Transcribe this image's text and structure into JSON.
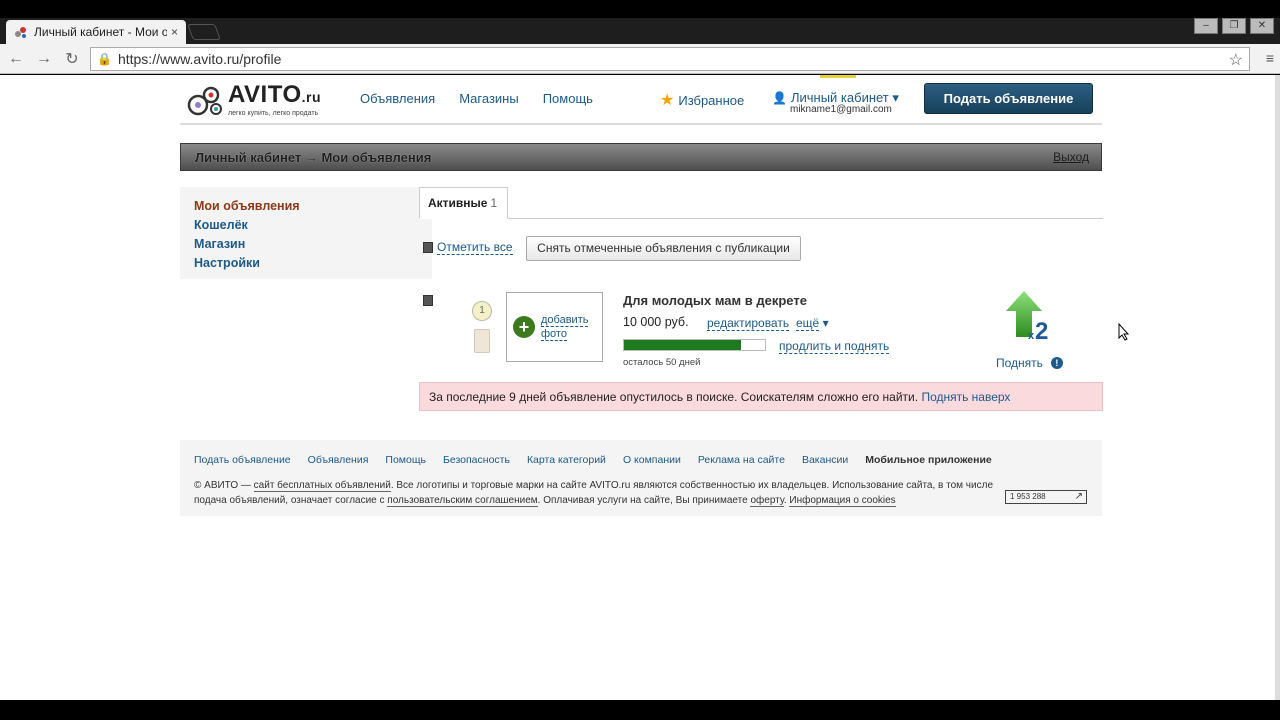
{
  "browser": {
    "tab_title": "Личный кабинет - Мои о",
    "tab_close": "×",
    "url": "https://www.avito.ru/profile"
  },
  "header": {
    "logo_name": "AVITO",
    "logo_suffix": ".ru",
    "logo_tagline": "легко купить, легко продать",
    "nav": [
      "Объявления",
      "Магазины",
      "Помощь"
    ],
    "favorites": "Избранное",
    "cabinet": "Личный кабинет ▾",
    "email": "mikname1@gmail.com",
    "post_button": "Подать объявление"
  },
  "breadcrumb": {
    "text": "Личный кабинет → Мои объявления",
    "exit": "Выход"
  },
  "sidebar": {
    "items": [
      "Мои объявления",
      "Кошелёк",
      "Магазин",
      "Настройки"
    ]
  },
  "tabs": {
    "active_label": "Активные",
    "active_count": "1"
  },
  "actions": {
    "mark_all": "Отметить все",
    "unpublish": "Снять отмеченные объявления с публикации"
  },
  "listing": {
    "rank": "1",
    "add_photo_1": "добавить",
    "add_photo_2": "фото",
    "title": "Для молодых мам в декрете",
    "price": "10 000 руб.",
    "edit": "редактировать",
    "more": "ещё",
    "more_arrow": "▾",
    "extend": "продлить и поднять",
    "remaining": "осталось 50 дней",
    "progress_fraction": 0.83,
    "raise_multiplier": "2",
    "raise_x": "x",
    "raise": "Поднять"
  },
  "warning": {
    "text": "За последние 9 дней объявление опустилось в поиске. Соискателям сложно его найти.",
    "lift_link": "Поднять наверх"
  },
  "footer": {
    "links": [
      "Подать объявление",
      "Объявления",
      "Помощь",
      "Безопасность",
      "Карта категорий",
      "О компании",
      "Реклама на сайте",
      "Вакансии"
    ],
    "app": "Мобильное приложение",
    "copy_1": "© АВИТО — ",
    "copy_link_1": "сайт бесплатных объявлений",
    "copy_2": ". Все логотипы и торговые марки на сайте AVITO.ru являются собственностью их владельцев. Использование сайта, в том числе подача объявлений, означает согласие с ",
    "copy_link_2": "пользовательским соглашением",
    "copy_3": ". Оплачивая услуги на сайте, Вы принимаете ",
    "copy_link_3": "оферту",
    "copy_4": ". ",
    "copy_link_4": "Информация о cookies",
    "counter": "1 953 288",
    "counter_arrow": "↗"
  },
  "colors": {
    "link": "#1b5a8a",
    "active_sidebar": "#8b3a1a",
    "post_button": "#1f4a68",
    "progress": "#1f7a1f",
    "warning_bg": "#fadadd",
    "raise_arrow": "#5cc24a"
  }
}
